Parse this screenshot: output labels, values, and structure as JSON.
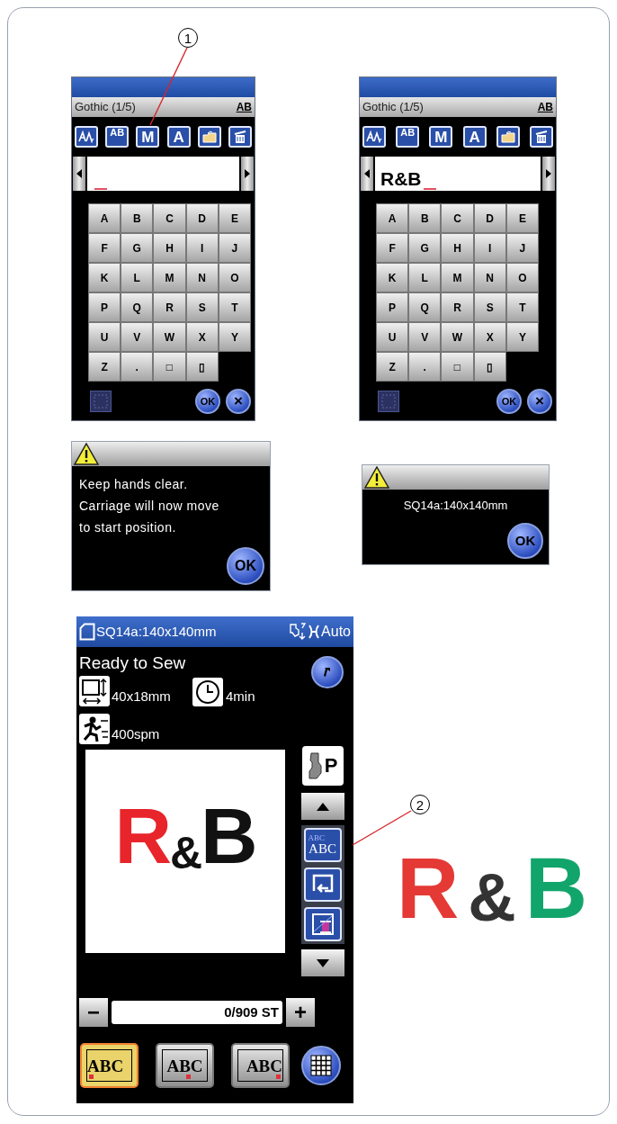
{
  "callouts": [
    {
      "label": "1"
    },
    {
      "label": "2"
    }
  ],
  "keyboard_screens": [
    {
      "title": "Gothic (1/5)",
      "case_label": "AB",
      "tools": [
        {
          "kind": "script"
        },
        {
          "kind": "text",
          "label": "AB"
        },
        {
          "kind": "text",
          "label": "M"
        },
        {
          "kind": "text",
          "label": "A"
        },
        {
          "kind": "folder"
        },
        {
          "kind": "delete"
        }
      ],
      "keys": [
        "A",
        "B",
        "C",
        "D",
        "E",
        "F",
        "G",
        "H",
        "I",
        "J",
        "K",
        "L",
        "M",
        "N",
        "O",
        "P",
        "Q",
        "R",
        "S",
        "T",
        "U",
        "V",
        "W",
        "X",
        "Y",
        "Z",
        ".",
        "□",
        "▯"
      ],
      "ok_label": "OK",
      "cancel_label": "×"
    },
    {
      "title": "Gothic (1/5)",
      "case_label": "AB",
      "tools": [
        {
          "kind": "script"
        },
        {
          "kind": "text",
          "label": "AB"
        },
        {
          "kind": "text",
          "label": "M"
        },
        {
          "kind": "text",
          "label": "A"
        },
        {
          "kind": "folder"
        },
        {
          "kind": "delete"
        }
      ],
      "value": "R&B",
      "keys": [
        "A",
        "B",
        "C",
        "D",
        "E",
        "F",
        "G",
        "H",
        "I",
        "J",
        "K",
        "L",
        "M",
        "N",
        "O",
        "P",
        "Q",
        "R",
        "S",
        "T",
        "U",
        "V",
        "W",
        "X",
        "Y",
        "Z",
        ".",
        "□",
        "▯"
      ],
      "ok_label": "OK",
      "cancel_label": "×"
    }
  ],
  "dialogs": [
    {
      "message": "Keep hands clear.\nCarriage will now move\nto start position.",
      "button": "OK"
    },
    {
      "message": "SQ14a:140x140mm",
      "button": "OK"
    }
  ],
  "main_screen": {
    "hoop": "SQ14a:140x140mm",
    "mode": "Auto",
    "status": "Ready to Sew",
    "size": "40x18mm",
    "time": "4min",
    "speed": "400spm",
    "preview": {
      "letters": [
        {
          "char": "R",
          "color": "#e8252b"
        },
        {
          "char": "&",
          "color": "#111111"
        },
        {
          "char": "B",
          "color": "#111111"
        }
      ]
    },
    "side_buttons": [
      {
        "kind": "foot",
        "label": "P"
      },
      {
        "kind": "up"
      },
      {
        "kind": "color_sort",
        "labels": [
          "ABC",
          "ABC"
        ]
      },
      {
        "kind": "return"
      },
      {
        "kind": "thread"
      },
      {
        "kind": "down"
      }
    ],
    "minus": "−",
    "counter": "0/909 ST",
    "plus": "+",
    "layouts": [
      {
        "label": "ABC",
        "kind": "left",
        "selected": true
      },
      {
        "label": "ABC",
        "kind": "center",
        "selected": false
      },
      {
        "label": "ABC",
        "kind": "right",
        "selected": false
      }
    ]
  },
  "illustration": {
    "letters": [
      {
        "char": "R",
        "color": "#e53935"
      },
      {
        "char": "&",
        "color": "#333333"
      },
      {
        "char": "B",
        "color": "#12a56b"
      }
    ]
  }
}
